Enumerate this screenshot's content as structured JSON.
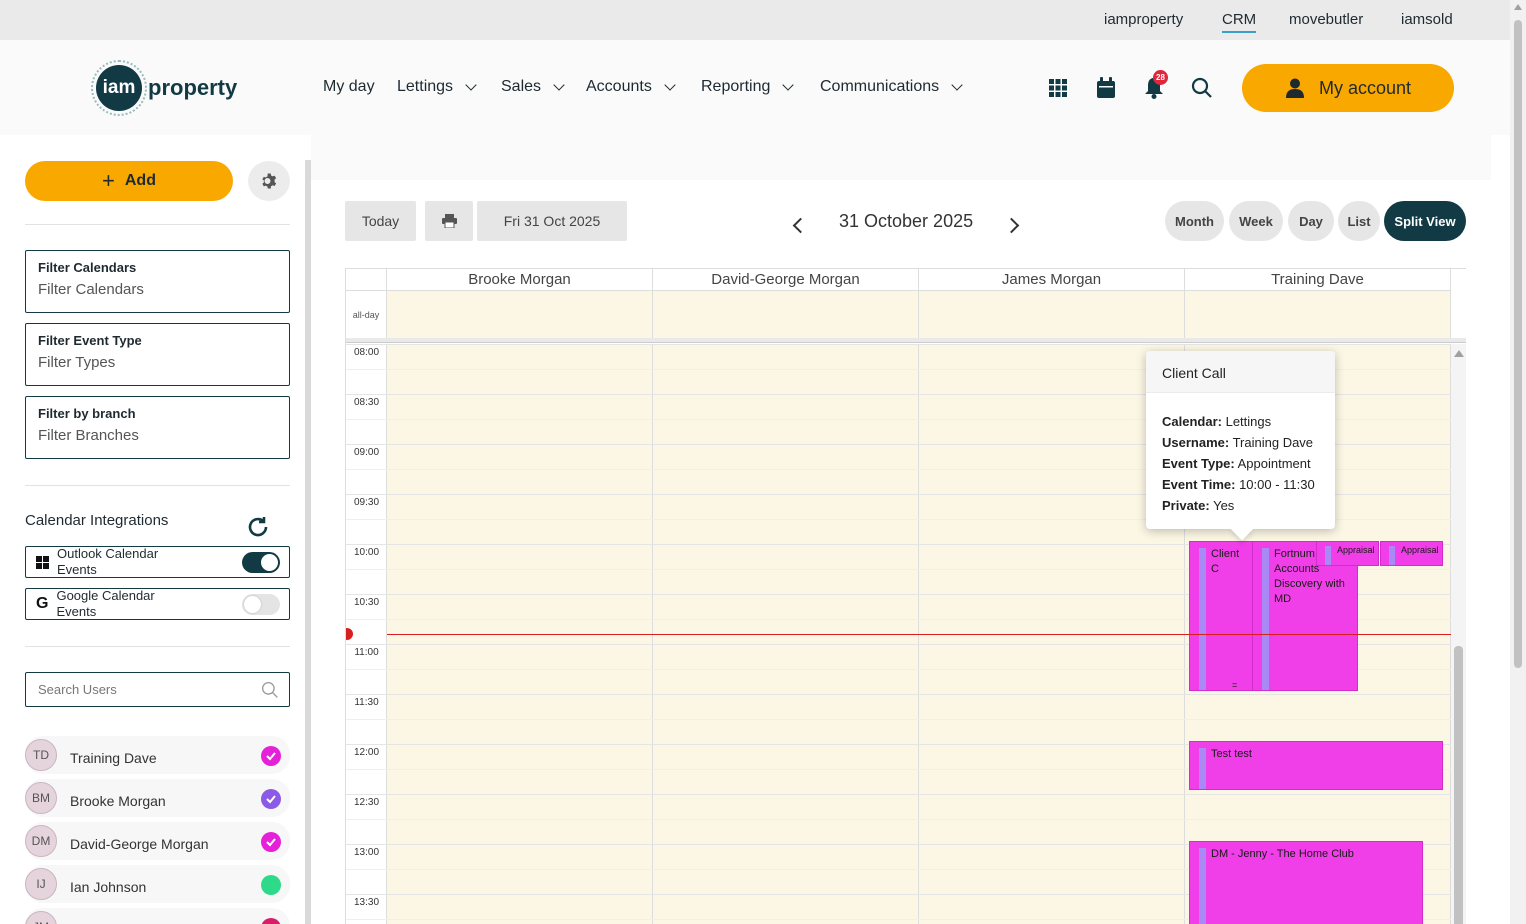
{
  "topbar": {
    "links": [
      "iamproperty",
      "CRM",
      "movebutler",
      "iamsold"
    ],
    "active": "CRM"
  },
  "logo": {
    "mark": "iam",
    "word": "property"
  },
  "nav": [
    "My day",
    "Lettings",
    "Sales",
    "Accounts",
    "Reporting",
    "Communications"
  ],
  "header": {
    "notification_count": "28",
    "account_label": "My account",
    "icons": [
      "apps-grid-icon",
      "calendar-icon",
      "bell-icon",
      "search-icon",
      "user-icon"
    ]
  },
  "sidebar": {
    "add_label": "Add",
    "filters": [
      {
        "label": "Filter Calendars",
        "placeholder": "Filter Calendars"
      },
      {
        "label": "Filter Event Type",
        "placeholder": "Filter Types"
      },
      {
        "label": "Filter by branch",
        "placeholder": "Filter Branches"
      }
    ],
    "integrations_title": "Calendar Integrations",
    "integrations": [
      {
        "label": "Outlook Calendar Events",
        "enabled": true,
        "icon": "windows-icon"
      },
      {
        "label": "Google Calendar Events",
        "enabled": false,
        "icon": "google-icon"
      }
    ],
    "search_placeholder": "Search Users",
    "users": [
      {
        "initials": "TD",
        "name": "Training Dave",
        "color": "#e520d8",
        "checked": true
      },
      {
        "initials": "BM",
        "name": "Brooke Morgan",
        "color": "#8b5be6",
        "checked": true
      },
      {
        "initials": "DM",
        "name": "David-George Morgan",
        "color": "#e520d8",
        "checked": true
      },
      {
        "initials": "IJ",
        "name": "Ian Johnson",
        "color": "#2ed98a",
        "checked": false
      },
      {
        "initials": "JM",
        "name": "",
        "color": "#d81e6a",
        "checked": false
      }
    ]
  },
  "toolbar": {
    "today_label": "Today",
    "date_label": "Fri 31 Oct 2025",
    "title": "31 October 2025",
    "views": [
      "Month",
      "Week",
      "Day",
      "List",
      "Split View"
    ],
    "active_view": "Split View"
  },
  "calendar": {
    "columns": [
      "Brooke Morgan",
      "David-George Morgan",
      "James Morgan",
      "Training Dave"
    ],
    "allday_label": "all-day",
    "times": [
      "08:00",
      "08:30",
      "09:00",
      "09:30",
      "10:00",
      "10:30",
      "11:00",
      "11:30",
      "12:00",
      "12:30",
      "13:00",
      "13:30"
    ],
    "events": [
      {
        "title": "Client C",
        "start": "10:00",
        "end": "11:30"
      },
      {
        "title": "Fortnum Accounts Discovery with MD",
        "start": "10:00",
        "end": "11:30"
      },
      {
        "title": "Appraisal",
        "start": "10:00",
        "end": "10:15"
      },
      {
        "title": "Appraisal",
        "start": "10:00",
        "end": "10:15"
      },
      {
        "title": "Test test",
        "start": "12:00",
        "end": "12:30"
      },
      {
        "title": "DM - Jenny - The Home Club",
        "start": "13:00",
        "end": ""
      }
    ],
    "event_color": "#f03ee8"
  },
  "popover": {
    "title": "Client Call",
    "rows": [
      {
        "key": "Calendar:",
        "value": "Lettings"
      },
      {
        "key": "Username:",
        "value": "Training Dave"
      },
      {
        "key": "Event Type:",
        "value": "Appointment"
      },
      {
        "key": "Event Time:",
        "value": "10:00 - 11:30"
      },
      {
        "key": "Private:",
        "value": "Yes"
      }
    ]
  }
}
